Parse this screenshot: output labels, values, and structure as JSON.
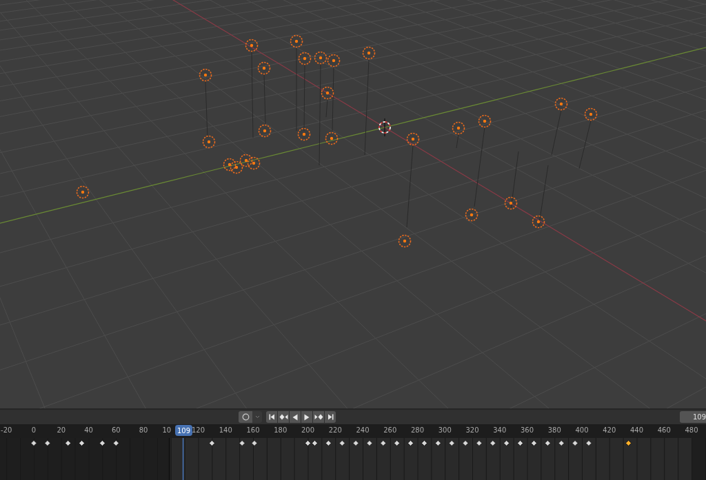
{
  "timeline": {
    "auto_keying": {
      "on": false
    },
    "current_frame": "109",
    "frame_field": {
      "value": "109"
    },
    "ruler": [
      "-20",
      "0",
      "20",
      "40",
      "60",
      "80",
      "10",
      "120",
      "140",
      "160",
      "180",
      "200",
      "220",
      "240",
      "260",
      "280",
      "300",
      "320",
      "340",
      "360",
      "380",
      "400",
      "420",
      "440",
      "460",
      "480"
    ],
    "keyframes": [
      {
        "selected": false
      },
      {
        "selected": false
      },
      {
        "selected": false
      },
      {
        "selected": false
      },
      {
        "selected": false
      },
      {
        "selected": false
      },
      {
        "selected": false
      },
      {
        "selected": false
      },
      {
        "selected": false
      },
      {
        "selected": false
      },
      {
        "selected": false
      },
      {
        "selected": false
      },
      {
        "selected": false
      },
      {
        "selected": false
      },
      {
        "selected": false
      },
      {
        "selected": false
      },
      {
        "selected": false
      },
      {
        "selected": false
      },
      {
        "selected": false
      },
      {
        "selected": false
      },
      {
        "selected": false
      },
      {
        "selected": false
      },
      {
        "selected": false
      },
      {
        "selected": false
      },
      {
        "selected": false
      },
      {
        "selected": false
      },
      {
        "selected": false
      },
      {
        "selected": false
      },
      {
        "selected": false
      },
      {
        "selected": false
      },
      {
        "selected": false
      },
      {
        "selected": true
      }
    ]
  }
}
